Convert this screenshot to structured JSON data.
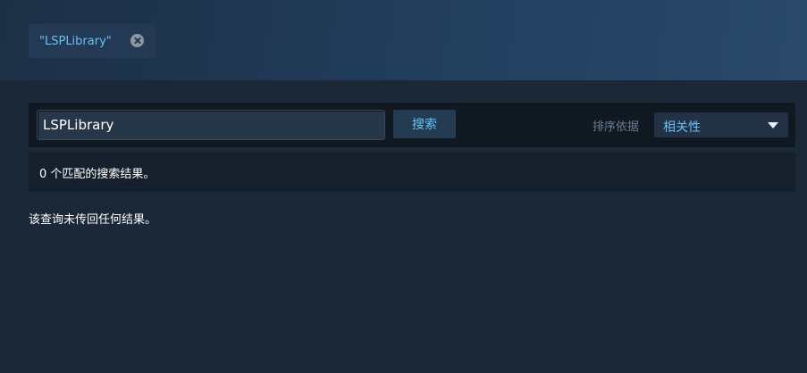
{
  "filter": {
    "tag_label": "\"LSPLibrary\""
  },
  "search": {
    "query": "LSPLibrary",
    "button_label": "搜索"
  },
  "sort": {
    "label": "排序依据",
    "selected": "相关性"
  },
  "results": {
    "count_text": "0 个匹配的搜索结果。",
    "empty_message": "该查询未传回任何结果。"
  },
  "colors": {
    "accent": "#67c1f5",
    "background": "#1b2838"
  }
}
